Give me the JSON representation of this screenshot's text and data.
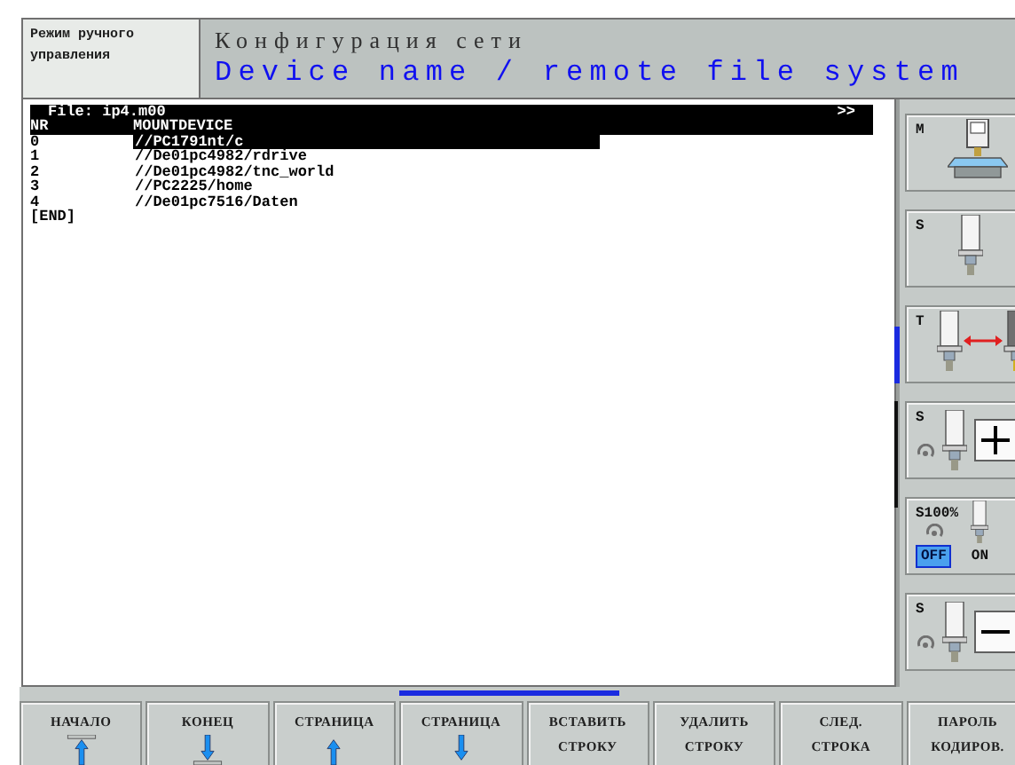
{
  "mode": "Режим ручного управления",
  "title": "Конфигурация сети",
  "subtitle": "Device name / remote file system",
  "file": {
    "label": "File: ip4.m00",
    "more": ">>"
  },
  "table": {
    "columns": [
      "NR",
      "MOUNTDEVICE"
    ],
    "rows": [
      {
        "nr": "0",
        "device": "//PC1791nt/c",
        "selected": true
      },
      {
        "nr": "1",
        "device": "//De01pc4982/rdrive",
        "selected": false
      },
      {
        "nr": "2",
        "device": "//De01pc4982/tnc_world",
        "selected": false
      },
      {
        "nr": "3",
        "device": "//PC2225/home",
        "selected": false
      },
      {
        "nr": "4",
        "device": "//De01pc7516/Daten",
        "selected": false
      }
    ],
    "end": "[END]"
  },
  "side_softkeys": [
    {
      "kind": "machine",
      "letter": "M"
    },
    {
      "kind": "spindle",
      "letter": "S"
    },
    {
      "kind": "tool-change",
      "letter": "T"
    },
    {
      "kind": "spindle-plus",
      "letter": "S"
    },
    {
      "kind": "toggle",
      "letter": "S100%",
      "options": [
        {
          "label": "OFF",
          "selected": true
        },
        {
          "label": "ON",
          "selected": false
        }
      ]
    },
    {
      "kind": "spindle-minus",
      "letter": "S"
    }
  ],
  "softkeys": [
    {
      "kind": "begin",
      "label": "НАЧАЛО"
    },
    {
      "kind": "end",
      "label": "КОНЕЦ"
    },
    {
      "kind": "page-up",
      "label": "СТРАНИЦА"
    },
    {
      "kind": "page-down",
      "label": "СТРАНИЦА"
    },
    {
      "kind": "text",
      "lines": [
        "ВСТАВИТЬ",
        "СТРОКУ"
      ]
    },
    {
      "kind": "text",
      "lines": [
        "УДАЛИТЬ",
        "СТРОКУ"
      ]
    },
    {
      "kind": "text",
      "lines": [
        "СЛЕД.",
        "СТРОКА"
      ]
    },
    {
      "kind": "text",
      "lines": [
        "ПАРОЛЬ",
        "КОДИРОВ."
      ]
    }
  ]
}
